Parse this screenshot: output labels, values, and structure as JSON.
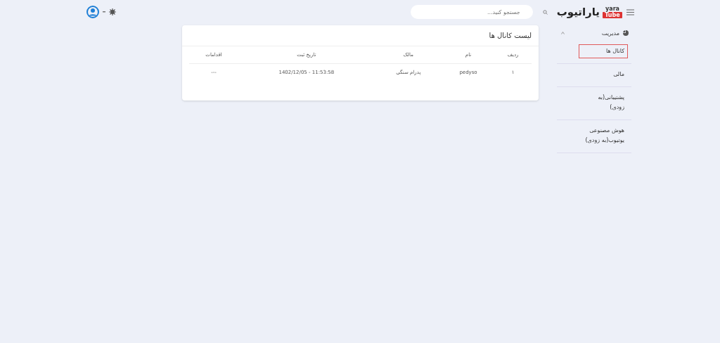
{
  "header": {
    "logo": {
      "badge_top": "yara",
      "badge_bottom": "Tube",
      "name": "یاراتیوب"
    },
    "search": {
      "placeholder": "جستجو کنید..."
    }
  },
  "sidebar": {
    "items": [
      {
        "label": "مدیریت",
        "expanded": true,
        "children": [
          {
            "label": "کانال ها",
            "selected": true
          },
          {
            "label": "مالی",
            "selected": false
          },
          {
            "label": "پشتیبانی(به زودی)",
            "selected": false
          },
          {
            "label": "هوش مصنوعی یوتیوب(به زودی)",
            "selected": false
          }
        ]
      }
    ]
  },
  "card": {
    "title": "لیست کانال ها",
    "table": {
      "columns": [
        "ردیف",
        "نام",
        "مالک",
        "تاریخ ثبت",
        "اقدامات"
      ],
      "rows": [
        [
          "۱",
          "pedyso",
          "پدرام سنگی",
          "1402/12/05 - 11:53:58",
          "---"
        ]
      ]
    }
  }
}
